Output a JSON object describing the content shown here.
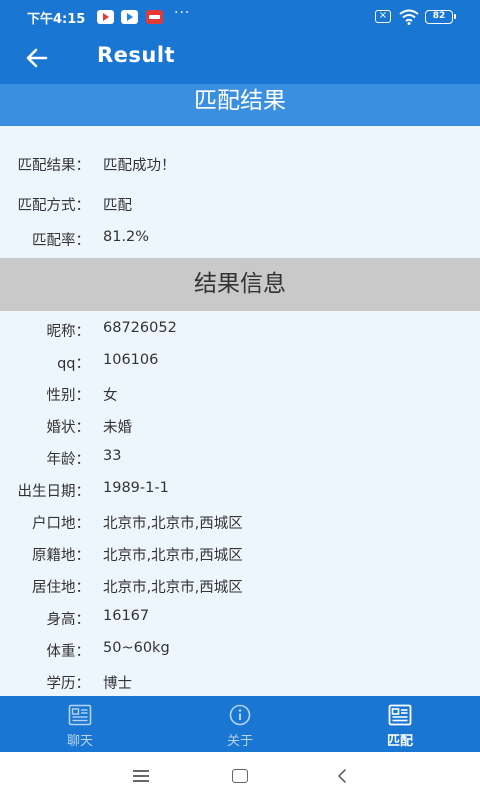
{
  "status_bar": {
    "time": "下午4:15",
    "more": "···",
    "battery": "82"
  },
  "app_bar": {
    "title": "Result"
  },
  "match_section": {
    "title": "匹配结果",
    "rows": [
      {
        "label": "匹配结果：",
        "value": "匹配成功！"
      },
      {
        "label": "匹配方式：",
        "value": "匹配"
      },
      {
        "label": "匹配率：",
        "value": "81.2%"
      }
    ]
  },
  "info_section": {
    "title": "结果信息",
    "rows": [
      {
        "label": "昵称：",
        "value": "68726052"
      },
      {
        "label": "qq：",
        "value": "106106"
      },
      {
        "label": "性别：",
        "value": "女"
      },
      {
        "label": "婚状：",
        "value": "未婚"
      },
      {
        "label": "年龄：",
        "value": "33"
      },
      {
        "label": "出生日期：",
        "value": "1989-1-1"
      },
      {
        "label": "户口地：",
        "value": "北京市,北京市,西城区"
      },
      {
        "label": "原籍地：",
        "value": "北京市,北京市,西城区"
      },
      {
        "label": "居住地：",
        "value": "北京市,北京市,西城区"
      },
      {
        "label": "身高：",
        "value": "16167"
      },
      {
        "label": "体重：",
        "value": "50~60kg"
      },
      {
        "label": "学历：",
        "value": "博士"
      }
    ]
  },
  "bottom_nav": {
    "items": [
      {
        "label": "聊天",
        "icon": "news-icon",
        "active": false
      },
      {
        "label": "关于",
        "icon": "info-icon",
        "active": false
      },
      {
        "label": "匹配",
        "icon": "news-icon",
        "active": true
      }
    ]
  },
  "colors": {
    "primary": "#1976d2",
    "section_blue": "#3b8fe0",
    "section_gray": "#c9c9c9",
    "content_bg": "#eef6fd"
  }
}
